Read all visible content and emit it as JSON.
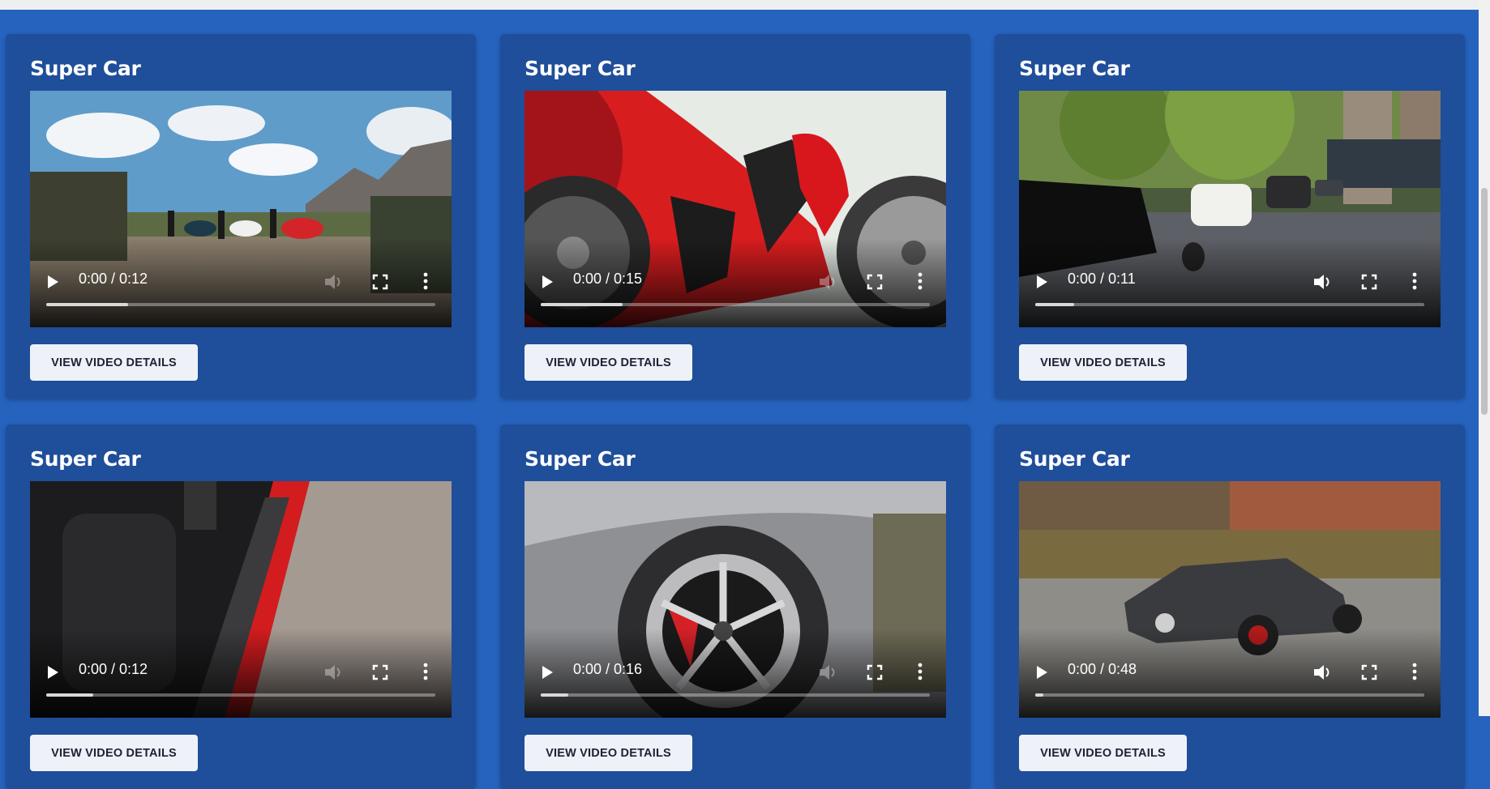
{
  "cards": [
    {
      "title": "Super Car",
      "time": "0:00 / 0:12",
      "buffered": 0.21,
      "muted": true,
      "button": "VIEW VIDEO DETAILS",
      "scene": "field"
    },
    {
      "title": "Super Car",
      "time": "0:00 / 0:15",
      "buffered": 0.21,
      "muted": true,
      "button": "VIEW VIDEO DETAILS",
      "scene": "redcar"
    },
    {
      "title": "Super Car",
      "time": "0:00 / 0:11",
      "buffered": 0.1,
      "muted": false,
      "button": "VIEW VIDEO DETAILS",
      "scene": "city"
    },
    {
      "title": "Super Car",
      "time": "0:00 / 0:12",
      "buffered": 0.12,
      "muted": true,
      "button": "VIEW VIDEO DETAILS",
      "scene": "interior"
    },
    {
      "title": "Super Car",
      "time": "0:00 / 0:16",
      "buffered": 0.07,
      "muted": true,
      "button": "VIEW VIDEO DETAILS",
      "scene": "wheel"
    },
    {
      "title": "Super Car",
      "time": "0:00 / 0:48",
      "buffered": 0.02,
      "muted": false,
      "button": "VIEW VIDEO DETAILS",
      "scene": "amg"
    }
  ],
  "colors": {
    "page_bg": "#2563bf",
    "card_bg": "#1f4e9a",
    "button_bg": "#eef1f8"
  }
}
